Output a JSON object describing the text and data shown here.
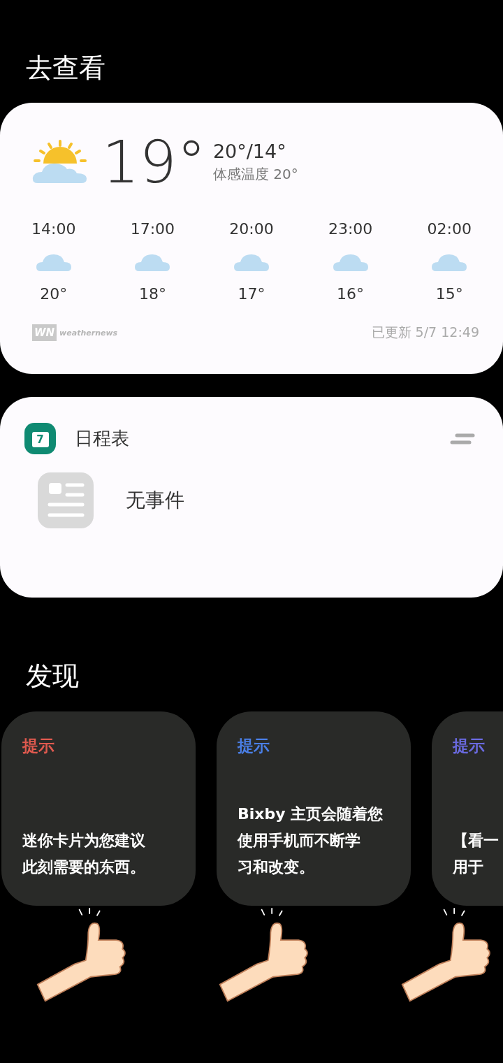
{
  "sections": [
    {
      "title": "去查看"
    },
    {
      "title": "发现"
    }
  ],
  "weather": {
    "temperature": "19°",
    "high_low": "20°/14°",
    "feels_like": "体感温度 20°",
    "hourly": [
      {
        "time": "14:00",
        "temp": "20°"
      },
      {
        "time": "17:00",
        "temp": "18°"
      },
      {
        "time": "20:00",
        "temp": "17°"
      },
      {
        "time": "23:00",
        "temp": "16°"
      },
      {
        "time": "02:00",
        "temp": "15°"
      }
    ],
    "logo_mark": "WN",
    "source": "weathernews",
    "updated": "已更新 5/7 12:49"
  },
  "schedule": {
    "icon_day": "7",
    "title": "日程表",
    "empty_text": "无事件"
  },
  "tips": [
    {
      "label": "提示",
      "color": "#e05a4f",
      "lines": [
        "迷你卡片为您建议",
        "此刻需要的东西。"
      ]
    },
    {
      "label": "提示",
      "color": "#4a7fe6",
      "lines": [
        "Bixby 主页会随着您",
        "使用手机而不断学",
        "习和改变。"
      ]
    },
    {
      "label": "提示",
      "color": "#6a6ae0",
      "lines": [
        "【看一",
        "用于"
      ]
    }
  ]
}
